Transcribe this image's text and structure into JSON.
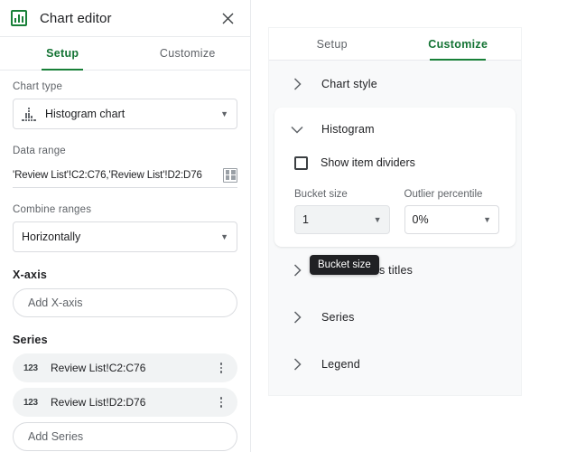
{
  "header": {
    "title": "Chart editor",
    "app_icon": "bar-chart-icon",
    "close_icon": "close-icon"
  },
  "left_panel": {
    "tabs": [
      {
        "label": "Setup",
        "active": true
      },
      {
        "label": "Customize",
        "active": false
      }
    ],
    "chart_type": {
      "label": "Chart type",
      "value": "Histogram chart",
      "icon": "histogram-icon"
    },
    "data_range": {
      "label": "Data range",
      "value": "'Review List'!C2:C76,'Review List'!D2:D76",
      "picker_icon": "grid-select-icon"
    },
    "combine_ranges": {
      "label": "Combine ranges",
      "value": "Horizontally"
    },
    "x_axis": {
      "label": "X-axis",
      "add_label": "Add X-axis"
    },
    "series": {
      "label": "Series",
      "items": [
        {
          "type_icon": "123",
          "label": "Review List!C2:C76",
          "menu_icon": "more-vert-icon"
        },
        {
          "type_icon": "123",
          "label": "Review List!D2:D76",
          "menu_icon": "more-vert-icon"
        }
      ],
      "add_label": "Add Series"
    }
  },
  "right_panel": {
    "tabs": [
      {
        "label": "Setup",
        "active": false
      },
      {
        "label": "Customize",
        "active": true
      }
    ],
    "sections": [
      {
        "label": "Chart style",
        "expanded": false
      },
      {
        "label": "Histogram",
        "expanded": true
      },
      {
        "label": "Chart & axis titles",
        "expanded": false
      },
      {
        "label": "Series",
        "expanded": false
      },
      {
        "label": "Legend",
        "expanded": false
      }
    ],
    "histogram": {
      "title": "Histogram",
      "show_item_dividers": {
        "label": "Show item dividers",
        "checked": false
      },
      "bucket_size": {
        "label": "Bucket size",
        "value": "1"
      },
      "outlier_percentile": {
        "label": "Outlier percentile",
        "value": "0%"
      }
    }
  },
  "tooltip": {
    "text": "Bucket size"
  },
  "colors": {
    "accent_green": "#188038",
    "text_primary": "#202124",
    "text_secondary": "#5f6368",
    "panel_bg": "#f8f9fa",
    "tooltip_bg": "#202124"
  }
}
